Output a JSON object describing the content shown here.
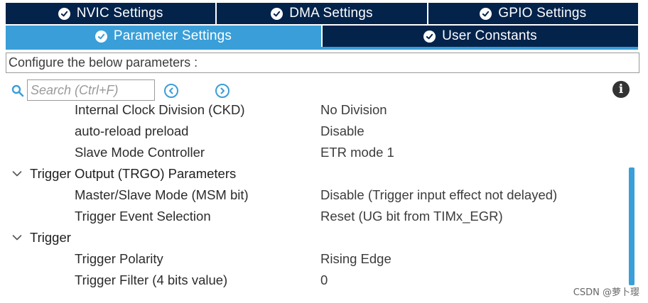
{
  "tabs": {
    "row1": [
      {
        "label": "NVIC Settings",
        "icon": "check-circle-icon"
      },
      {
        "label": "DMA Settings",
        "icon": "check-circle-icon"
      },
      {
        "label": "GPIO Settings",
        "icon": "check-circle-icon"
      }
    ],
    "row2": [
      {
        "label": "Parameter Settings",
        "icon": "check-circle-icon",
        "active": true
      },
      {
        "label": "User Constants",
        "icon": "check-circle-icon"
      }
    ]
  },
  "config_text": "Configure the below parameters :",
  "search": {
    "placeholder": "Search (Ctrl+F)"
  },
  "info_label": "i",
  "params": [
    {
      "name": "Internal Clock Division (CKD)",
      "value": "No Division"
    },
    {
      "name": "auto-reload preload",
      "value": "Disable"
    },
    {
      "name": "Slave Mode Controller",
      "value": "ETR mode 1"
    },
    {
      "group": "Trigger Output (TRGO) Parameters"
    },
    {
      "name": "Master/Slave Mode (MSM bit)",
      "value": "Disable (Trigger input effect not delayed)"
    },
    {
      "name": "Trigger Event Selection",
      "value": "Reset (UG bit from TIMx_EGR)"
    },
    {
      "group": "Trigger"
    },
    {
      "name": "Trigger Polarity",
      "value": "Rising Edge"
    },
    {
      "name": "Trigger Filter (4 bits value)",
      "value": "0"
    }
  ],
  "watermark": "CSDN @萝卜璎",
  "colors": {
    "tab_dark": "#03234b",
    "tab_active": "#3a9ed8",
    "scroll_thumb": "#3a9ed8"
  }
}
